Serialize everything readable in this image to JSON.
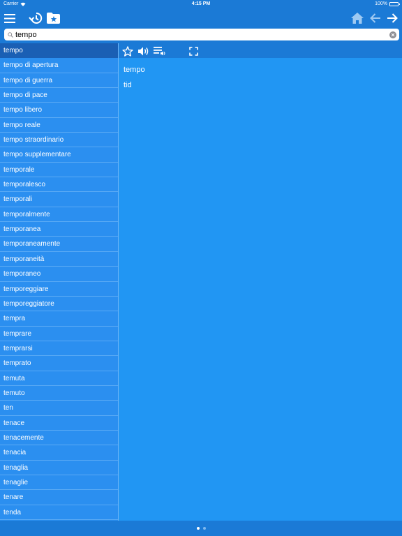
{
  "status_bar": {
    "carrier": "Carrier",
    "time": "4:15 PM",
    "battery": "100%"
  },
  "toolbar": {
    "menu_icon": "hamburger-menu-icon",
    "history_icon": "history-icon",
    "favorites_icon": "favorites-folder-icon",
    "home_icon": "home-icon",
    "back_icon": "arrow-left-icon",
    "forward_icon": "arrow-right-icon"
  },
  "search": {
    "value": "tempo",
    "placeholder": ""
  },
  "word_list": {
    "selected_index": 0,
    "items": [
      "tempo",
      "tempo di apertura",
      "tempo di guerra",
      "tempo di pace",
      "tempo libero",
      "tempo reale",
      "tempo straordinario",
      "tempo supplementare",
      "temporale",
      "temporalesco",
      "temporali",
      "temporalmente",
      "temporanea",
      "temporaneamente",
      "temporaneità",
      "temporaneo",
      "temporeggiare",
      "temporeggiatore",
      "tempra",
      "temprare",
      "temprarsi",
      "temprato",
      "temuta",
      "temuto",
      "ten",
      "tenace",
      "tenacemente",
      "tenacia",
      "tenaglia",
      "tenaglie",
      "tenare",
      "tenda"
    ]
  },
  "detail": {
    "headword": "tempo",
    "translation": "tid"
  },
  "pager": {
    "count": 2,
    "active": 0
  },
  "colors": {
    "background": "#1b7ad6",
    "list": "#2b8ff0",
    "selected": "#1a5fb4",
    "detail": "#2196f3"
  }
}
